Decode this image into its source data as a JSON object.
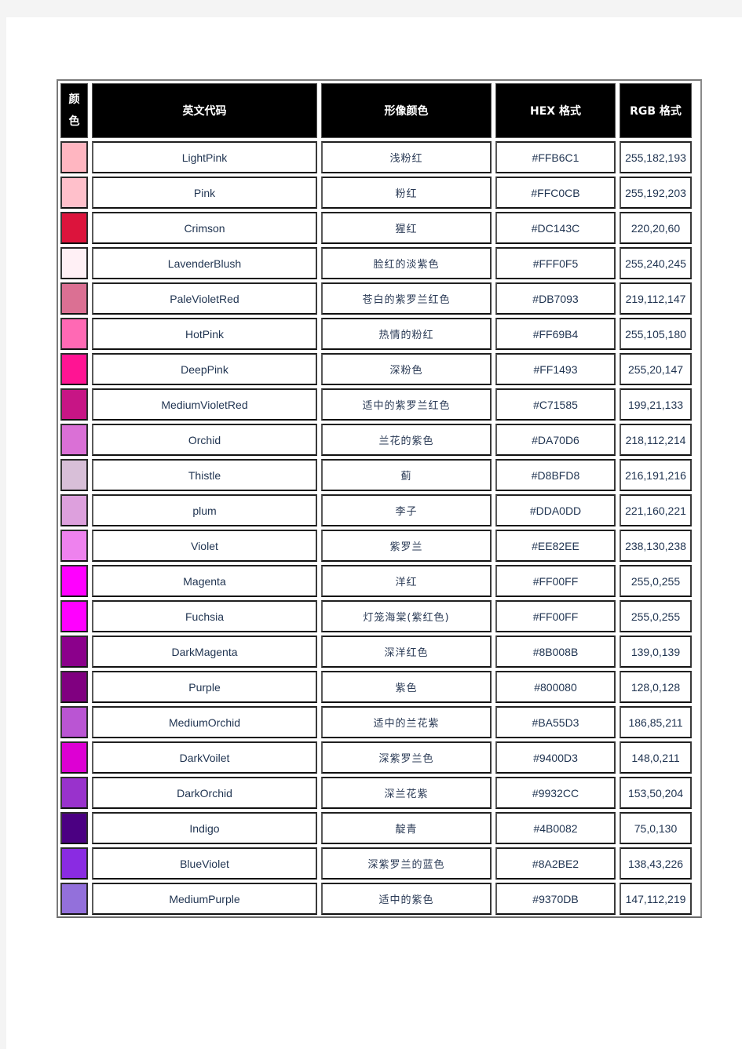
{
  "table": {
    "headers": {
      "swatch": [
        "颜",
        "色"
      ],
      "english_name": "英文代码",
      "chinese_name": "形像颜色",
      "hex": "HEX 格式",
      "rgb": "RGB 格式"
    },
    "rows": [
      {
        "swatch_color": "#FFB6C1",
        "english_name": "LightPink",
        "chinese_name": "浅粉红",
        "hex": "#FFB6C1",
        "rgb": "255,182,193"
      },
      {
        "swatch_color": "#FFC0CB",
        "english_name": "Pink",
        "chinese_name": "粉红",
        "hex": "#FFC0CB",
        "rgb": "255,192,203"
      },
      {
        "swatch_color": "#DC143C",
        "english_name": "Crimson",
        "chinese_name": "猩红",
        "hex": "#DC143C",
        "rgb": "220,20,60"
      },
      {
        "swatch_color": "#FFF0F5",
        "english_name": "LavenderBlush",
        "chinese_name": "脸红的淡紫色",
        "hex": "#FFF0F5",
        "rgb": "255,240,245"
      },
      {
        "swatch_color": "#DB7093",
        "english_name": "PaleVioletRed",
        "chinese_name": "苍白的紫罗兰红色",
        "hex": "#DB7093",
        "rgb": "219,112,147"
      },
      {
        "swatch_color": "#FF69B4",
        "english_name": "HotPink",
        "chinese_name": "热情的粉红",
        "hex": "#FF69B4",
        "rgb": "255,105,180"
      },
      {
        "swatch_color": "#FF1493",
        "english_name": "DeepPink",
        "chinese_name": "深粉色",
        "hex": "#FF1493",
        "rgb": "255,20,147"
      },
      {
        "swatch_color": "#C71585",
        "english_name": "MediumVioletRed",
        "chinese_name": "适中的紫罗兰红色",
        "hex": "#C71585",
        "rgb": "199,21,133"
      },
      {
        "swatch_color": "#DA70D6",
        "english_name": "Orchid",
        "chinese_name": "兰花的紫色",
        "hex": "#DA70D6",
        "rgb": "218,112,214"
      },
      {
        "swatch_color": "#D8BFD8",
        "english_name": "Thistle",
        "chinese_name": "蓟",
        "hex": "#D8BFD8",
        "rgb": "216,191,216"
      },
      {
        "swatch_color": "#DDA0DD",
        "english_name": "plum",
        "chinese_name": "李子",
        "hex": "#DDA0DD",
        "rgb": "221,160,221"
      },
      {
        "swatch_color": "#EE82EE",
        "english_name": "Violet",
        "chinese_name": "紫罗兰",
        "hex": "#EE82EE",
        "rgb": "238,130,238"
      },
      {
        "swatch_color": "#FF00FF",
        "english_name": "Magenta",
        "chinese_name": "洋红",
        "hex": "#FF00FF",
        "rgb": "255,0,255"
      },
      {
        "swatch_color": "#FF00FF",
        "english_name": "Fuchsia",
        "chinese_name": "灯笼海棠(紫红色)",
        "hex": "#FF00FF",
        "rgb": "255,0,255"
      },
      {
        "swatch_color": "#8B008B",
        "english_name": "DarkMagenta",
        "chinese_name": "深洋红色",
        "hex": "#8B008B",
        "rgb": "139,0,139"
      },
      {
        "swatch_color": "#800080",
        "english_name": "Purple",
        "chinese_name": "紫色",
        "hex": "#800080",
        "rgb": "128,0,128"
      },
      {
        "swatch_color": "#BA55D3",
        "english_name": "MediumOrchid",
        "chinese_name": "适中的兰花紫",
        "hex": "#BA55D3",
        "rgb": "186,85,211"
      },
      {
        "swatch_color": "#DD00D3",
        "english_name": "DarkVoilet",
        "chinese_name": "深紫罗兰色",
        "hex": "#9400D3",
        "rgb": "148,0,211"
      },
      {
        "swatch_color": "#9932CC",
        "english_name": "DarkOrchid",
        "chinese_name": "深兰花紫",
        "hex": "#9932CC",
        "rgb": "153,50,204"
      },
      {
        "swatch_color": "#4B0082",
        "english_name": "Indigo",
        "chinese_name": "靛青",
        "hex": "#4B0082",
        "rgb": "75,0,130"
      },
      {
        "swatch_color": "#8A2BE2",
        "english_name": "BlueViolet",
        "chinese_name": "深紫罗兰的蓝色",
        "hex": "#8A2BE2",
        "rgb": "138,43,226"
      },
      {
        "swatch_color": "#9370DB",
        "english_name": "MediumPurple",
        "chinese_name": "适中的紫色",
        "hex": "#9370DB",
        "rgb": "147,112,219"
      }
    ]
  }
}
